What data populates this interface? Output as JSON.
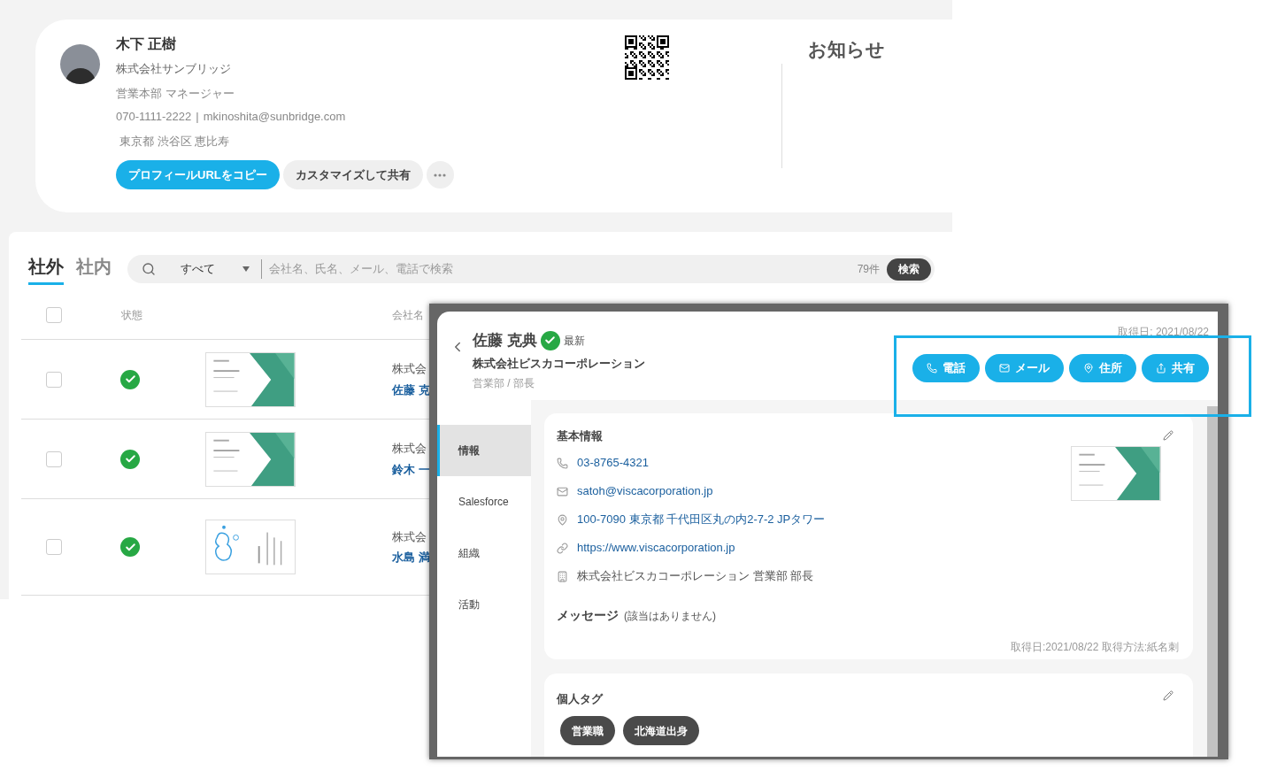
{
  "profile": {
    "name": "木下 正樹",
    "company": "株式会社サンブリッジ",
    "title": "営業本部 マネージャー",
    "phone": "070-1111-2222",
    "separator": "|",
    "email": "mkinoshita@sunbridge.com",
    "address": "東京都 渋谷区 恵比寿",
    "buttons": [
      {
        "label": "プロフィールURLをコピー",
        "kind": "primary"
      },
      {
        "label": "カスタマイズして共有",
        "kind": "secondary"
      }
    ]
  },
  "notices": {
    "title": "お知らせ"
  },
  "list": {
    "tabs": [
      {
        "label": "社外",
        "selected": true
      },
      {
        "label": "社内",
        "selected": false
      }
    ],
    "search": {
      "filter": "すべて",
      "placeholder": "会社名、氏名、メール、電話で検索",
      "count": "79件",
      "button": "検索"
    },
    "header_checkbox": {
      "checked": false
    },
    "columns": [
      "状態",
      "会社名"
    ],
    "rows": [
      {
        "checked": false,
        "verified": true,
        "kind": "green",
        "company": "株式会",
        "name": "佐藤 克"
      },
      {
        "checked": false,
        "verified": true,
        "kind": "green",
        "company": "株式会",
        "name": "鈴木 一"
      },
      {
        "checked": false,
        "verified": true,
        "kind": "drop",
        "company": "株式会",
        "name": "水島 満"
      }
    ]
  },
  "detail": {
    "name": "佐藤 克典",
    "verified": true,
    "status": "最新",
    "company": "株式会社ビスカコーポレーション",
    "department": "営業部 / 部長",
    "acquired": "取得日: 2021/08/22",
    "actions": [
      {
        "label": "電話",
        "kind": "phone"
      },
      {
        "label": "メール",
        "kind": "mail"
      },
      {
        "label": "住所",
        "kind": "pin"
      },
      {
        "label": "共有",
        "kind": "share"
      }
    ],
    "nav": [
      {
        "label": "情報",
        "selected": true
      },
      {
        "label": "Salesforce",
        "selected": false
      },
      {
        "label": "組織",
        "selected": false
      },
      {
        "label": "活動",
        "selected": false
      }
    ],
    "basic_info": {
      "title": "基本情報",
      "items": [
        {
          "kind": "phone",
          "text": "03-8765-4321"
        },
        {
          "kind": "email",
          "text": "satoh@viscacorporation.jp"
        },
        {
          "kind": "address",
          "text": "100-7090 東京都 千代田区丸の内2-7-2 JPタワー"
        },
        {
          "kind": "url",
          "text": "https://www.viscacorporation.jp"
        },
        {
          "kind": "org",
          "text": "株式会社ビスカコーポレーション 営業部 部長"
        }
      ],
      "message_label": "メッセージ",
      "message_value": "(該当はありません)",
      "footer": "取得日:2021/08/22 取得方法:紙名刺"
    },
    "tags": {
      "title": "個人タグ",
      "items": [
        "営業職",
        "北海道出身"
      ]
    }
  }
}
